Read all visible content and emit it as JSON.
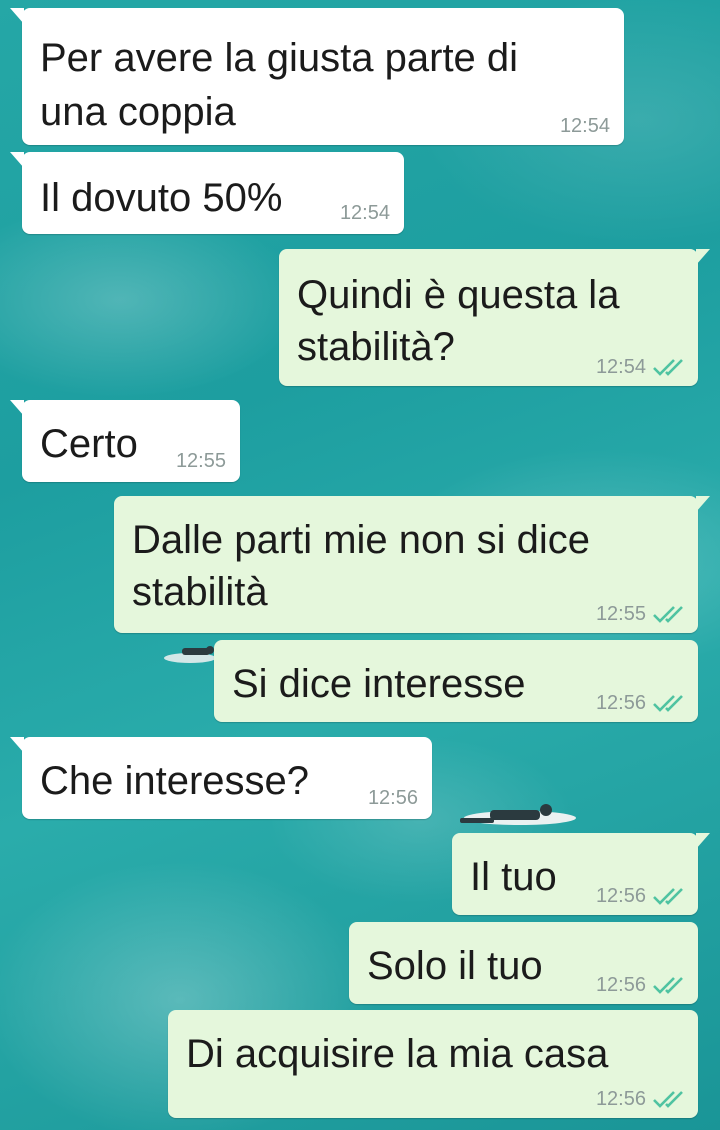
{
  "messages": [
    {
      "text_lines": [
        "Per avere la giusta parte di",
        "una coppia"
      ],
      "time": "12:54",
      "dir": "in"
    },
    {
      "text_lines": [
        "Il dovuto 50%"
      ],
      "time": "12:54",
      "dir": "in"
    },
    {
      "text_lines": [
        "Quindi è questa la",
        "stabilità?"
      ],
      "time": "12:54",
      "dir": "out",
      "status": "read"
    },
    {
      "text_lines": [
        "Certo"
      ],
      "time": "12:55",
      "dir": "in"
    },
    {
      "text_lines": [
        "Dalle parti mie non si dice",
        "stabilità"
      ],
      "time": "12:55",
      "dir": "out",
      "status": "read"
    },
    {
      "text_lines": [
        "Si dice interesse"
      ],
      "time": "12:56",
      "dir": "out",
      "status": "read"
    },
    {
      "text_lines": [
        "Che interesse?"
      ],
      "time": "12:56",
      "dir": "in"
    },
    {
      "text_lines": [
        "Il tuo"
      ],
      "time": "12:56",
      "dir": "out",
      "status": "read"
    },
    {
      "text_lines": [
        "Solo il tuo"
      ],
      "time": "12:56",
      "dir": "out",
      "status": "read"
    },
    {
      "text_lines": [
        "Di acquisire la mia casa"
      ],
      "time": "12:56",
      "dir": "out",
      "status": "read"
    }
  ],
  "colors": {
    "incoming_bubble": "#ffffff",
    "outgoing_bubble": "#e5f7dc",
    "read_ticks": "#34b7f1",
    "background": "#1d9ea0"
  },
  "icons": {
    "read_status": "double-check-icon"
  }
}
